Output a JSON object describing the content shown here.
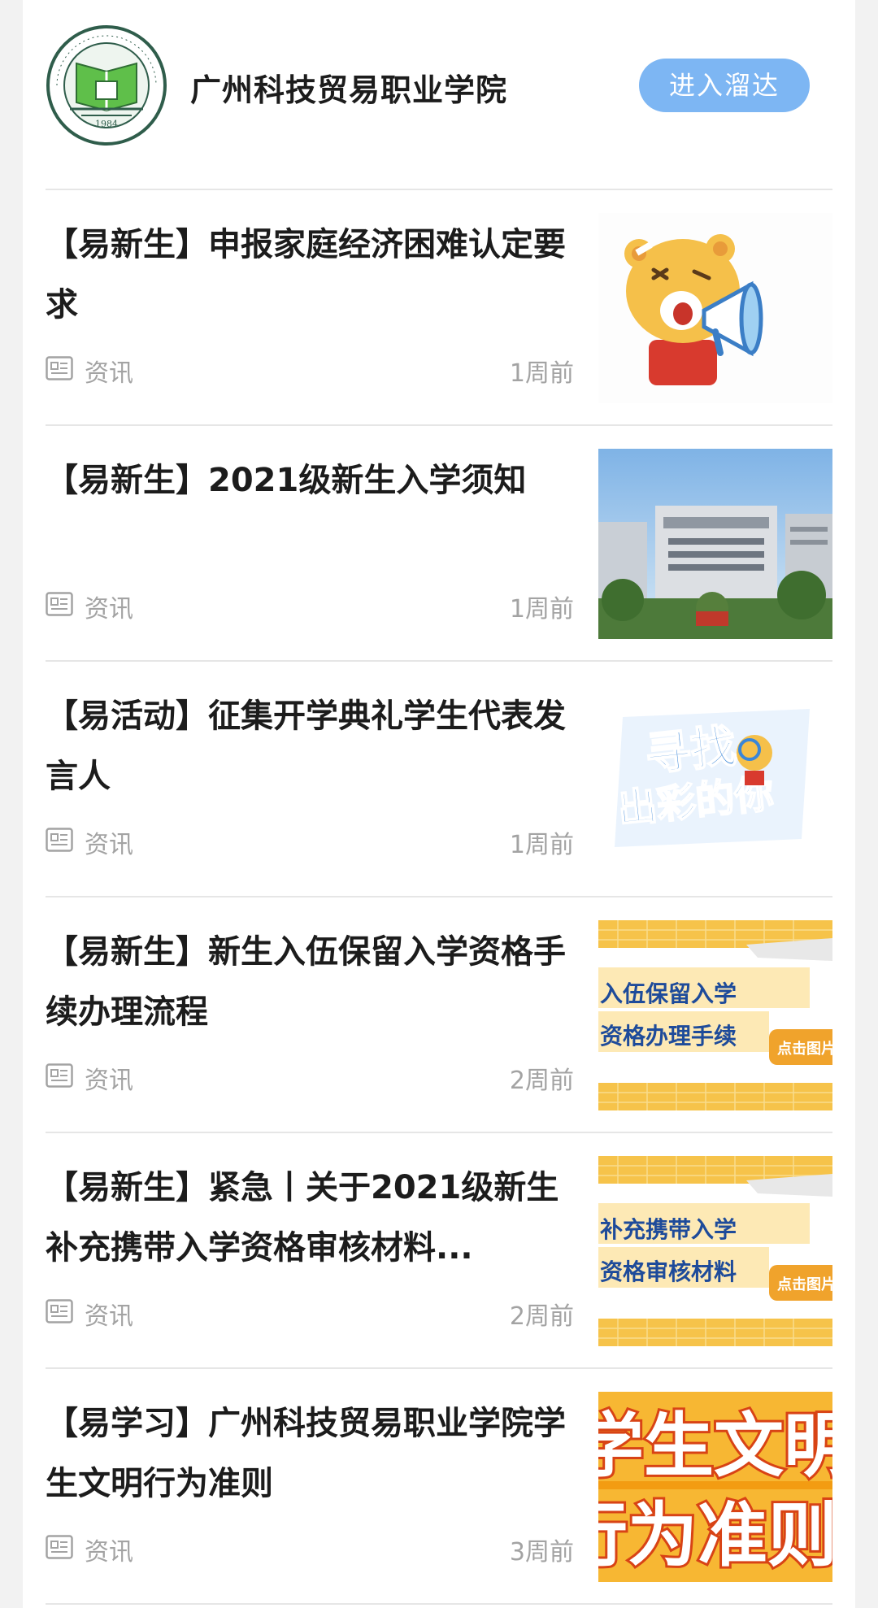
{
  "header": {
    "school_name": "广州科技贸易职业学院",
    "enter_button": "进入溜达",
    "logo_icon": "college-seal-logo",
    "logo_year": "1984"
  },
  "articles": [
    {
      "title": "【易新生】申报家庭经济困难认定要求",
      "category": "资讯",
      "time": "1周前",
      "thumb_icon": "bear-megaphone-image"
    },
    {
      "title": "【易新生】2021级新生入学须知",
      "category": "资讯",
      "time": "1周前",
      "thumb_icon": "campus-building-photo"
    },
    {
      "title": "【易活动】征集开学典礼学生代表发言人",
      "category": "资讯",
      "time": "1周前",
      "thumb_icon": "search-banner-image",
      "thumb_line1": "寻找",
      "thumb_line2": "出彩的你"
    },
    {
      "title": "【易新生】新生入伍保留入学资格手续办理流程",
      "category": "资讯",
      "time": "2周前",
      "thumb_icon": "notice-banner-image",
      "thumb_line1": "入伍保留入学",
      "thumb_line2": "资格办理手续",
      "thumb_tag": "点击图片"
    },
    {
      "title": "【易新生】紧急丨关于2021级新生补充携带入学资格审核材料...",
      "category": "资讯",
      "time": "2周前",
      "thumb_icon": "notice-banner-image",
      "thumb_line1": "补充携带入学",
      "thumb_line2": "资格审核材料",
      "thumb_tag": "点击图片"
    },
    {
      "title": "【易学习】广州科技贸易职业学院学生文明行为准则",
      "category": "资讯",
      "time": "3周前",
      "thumb_icon": "rules-banner-image",
      "thumb_line1": "学生文明",
      "thumb_line2": "行为准则"
    }
  ],
  "colors": {
    "button": "#7db6f3",
    "banner_yellow": "#f6c34a",
    "banner_blue": "#1e4b9a"
  }
}
